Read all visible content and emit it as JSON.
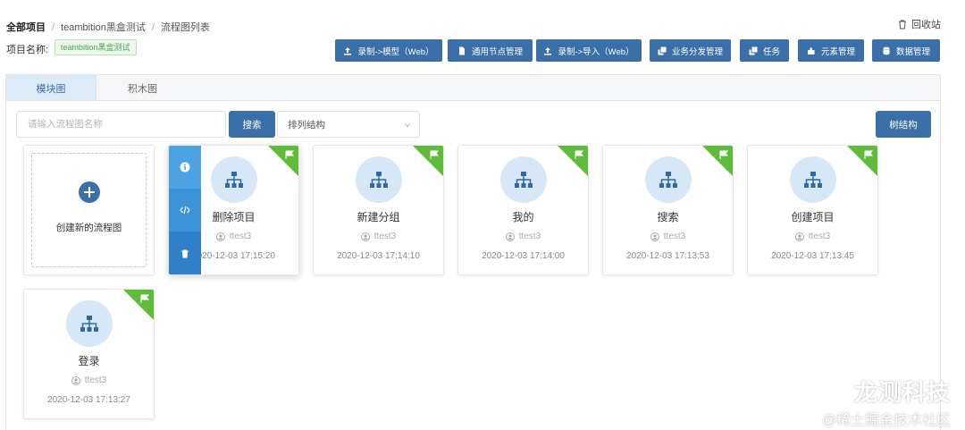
{
  "breadcrumb": {
    "root": "全部项目",
    "project": "teambition黑盒测试",
    "current": "流程图列表"
  },
  "recycle_label": "回收站",
  "project_name_label": "项目名称:",
  "project_tag": "teambition黑盒测试",
  "toolbar": [
    {
      "label": "录制->模型（Web）",
      "icon": "upload-icon"
    },
    {
      "label": "通用节点管理",
      "icon": "document-icon"
    },
    {
      "label": "录制->导入（Web）",
      "icon": "upload-icon"
    },
    {
      "label": "业务分发管理",
      "icon": "copy-icon"
    },
    {
      "label": "任务",
      "icon": "copy-icon"
    },
    {
      "label": "元素管理",
      "icon": "puzzle-icon"
    },
    {
      "label": "数据管理",
      "icon": "database-icon"
    }
  ],
  "tabs": [
    {
      "label": "模块图",
      "active": true
    },
    {
      "label": "积木图",
      "active": false
    }
  ],
  "search": {
    "placeholder": "请输入流程图名称",
    "button": "搜索"
  },
  "sort_select": {
    "value": "排列结构"
  },
  "tree_button": "树结构",
  "new_card_label": "创建新的流程图",
  "cards": [
    {
      "title": "删除项目",
      "user": "ttest3",
      "time": "2020-12-03 17:15:20"
    },
    {
      "title": "新建分组",
      "user": "ttest3",
      "time": "2020-12-03 17:14:10"
    },
    {
      "title": "我的",
      "user": "ttest3",
      "time": "2020-12-03 17:14:00"
    },
    {
      "title": "搜索",
      "user": "ttest3",
      "time": "2020-12-03 17:13:53"
    },
    {
      "title": "创建项目",
      "user": "ttest3",
      "time": "2020-12-03 17:13:45"
    },
    {
      "title": "登录",
      "user": "ttest3",
      "time": "2020-12-03 17:13:27"
    }
  ],
  "hover_actions": [
    {
      "icon": "info-icon",
      "color": "#4a9fe0"
    },
    {
      "icon": "code-icon",
      "color": "#3b8fd6"
    },
    {
      "icon": "trash-icon",
      "color": "#2f7fc7"
    }
  ],
  "watermark": {
    "title": "龙测科技",
    "subtitle": "@稀土掘金技术社区"
  },
  "colors": {
    "primary": "#3a6fa8",
    "flag": "#5fbb3a",
    "circle": "#d6e8f8"
  }
}
